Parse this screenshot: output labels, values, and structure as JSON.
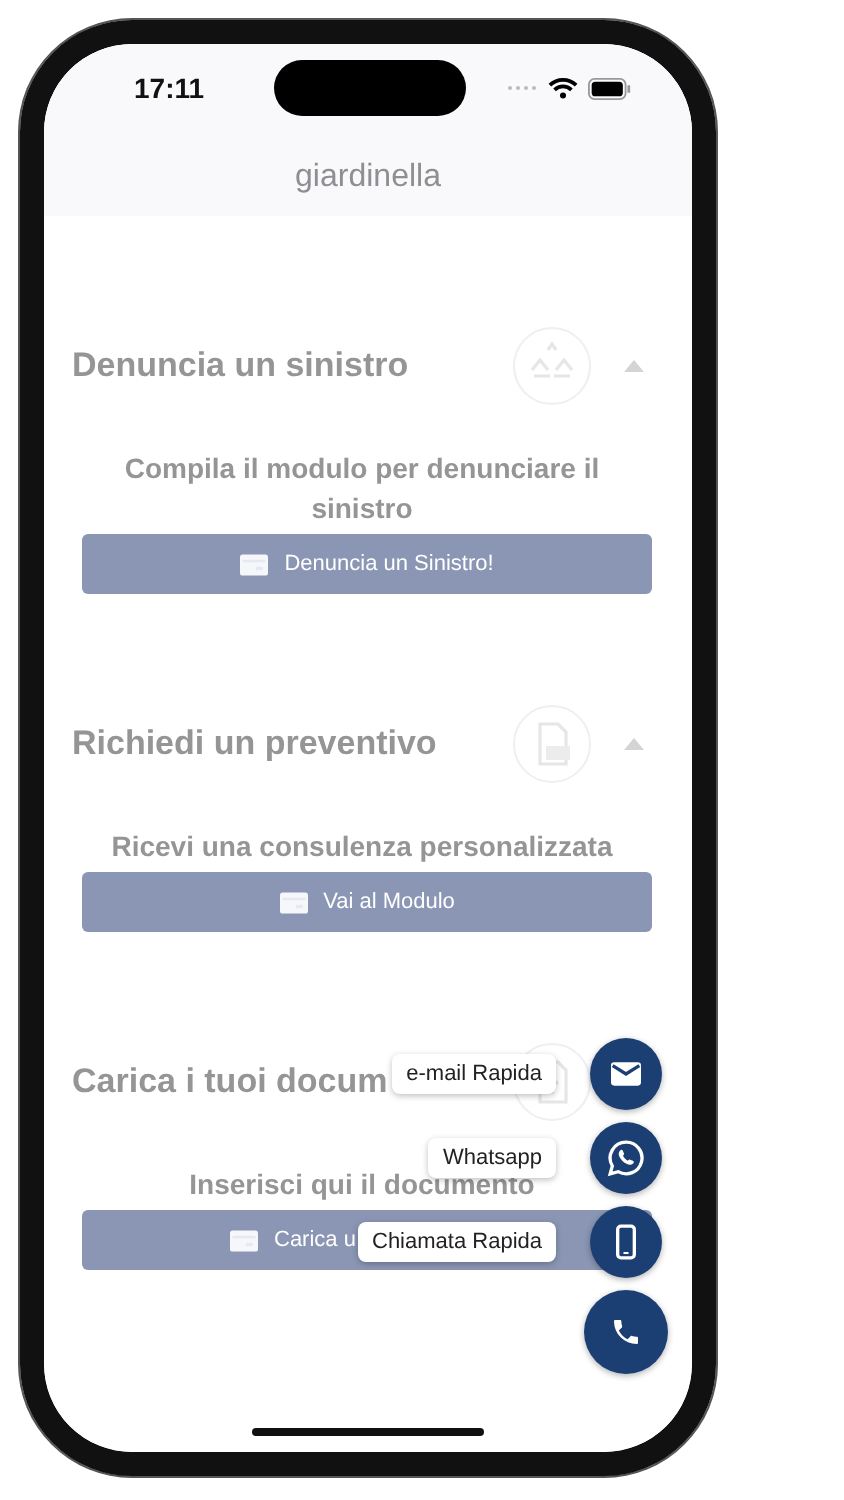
{
  "status_bar": {
    "time": "17:11"
  },
  "header": {
    "title": "giardinella"
  },
  "sections": [
    {
      "title": "Denuncia un sinistro",
      "expanded": true,
      "description": "Compila il modulo per denunciare il sinistro",
      "button": "Denuncia un Sinistro!"
    },
    {
      "title": "Richiedi un preventivo",
      "expanded": true,
      "description": "Ricevi una consulenza personalizzata",
      "button": "Vai al Modulo"
    },
    {
      "title": "Carica i tuoi docum",
      "expanded": true,
      "caret_covered": true,
      "description": "Inserisci qui il documento",
      "button": "Carica u",
      "button_covered": true
    }
  ],
  "fab": {
    "open": true,
    "actions": [
      {
        "label": "e-mail Rapida",
        "kind": "email"
      },
      {
        "label": "Whatsapp",
        "kind": "whatsapp"
      },
      {
        "label": "Chiamata Rapida",
        "kind": "mobile"
      }
    ]
  }
}
